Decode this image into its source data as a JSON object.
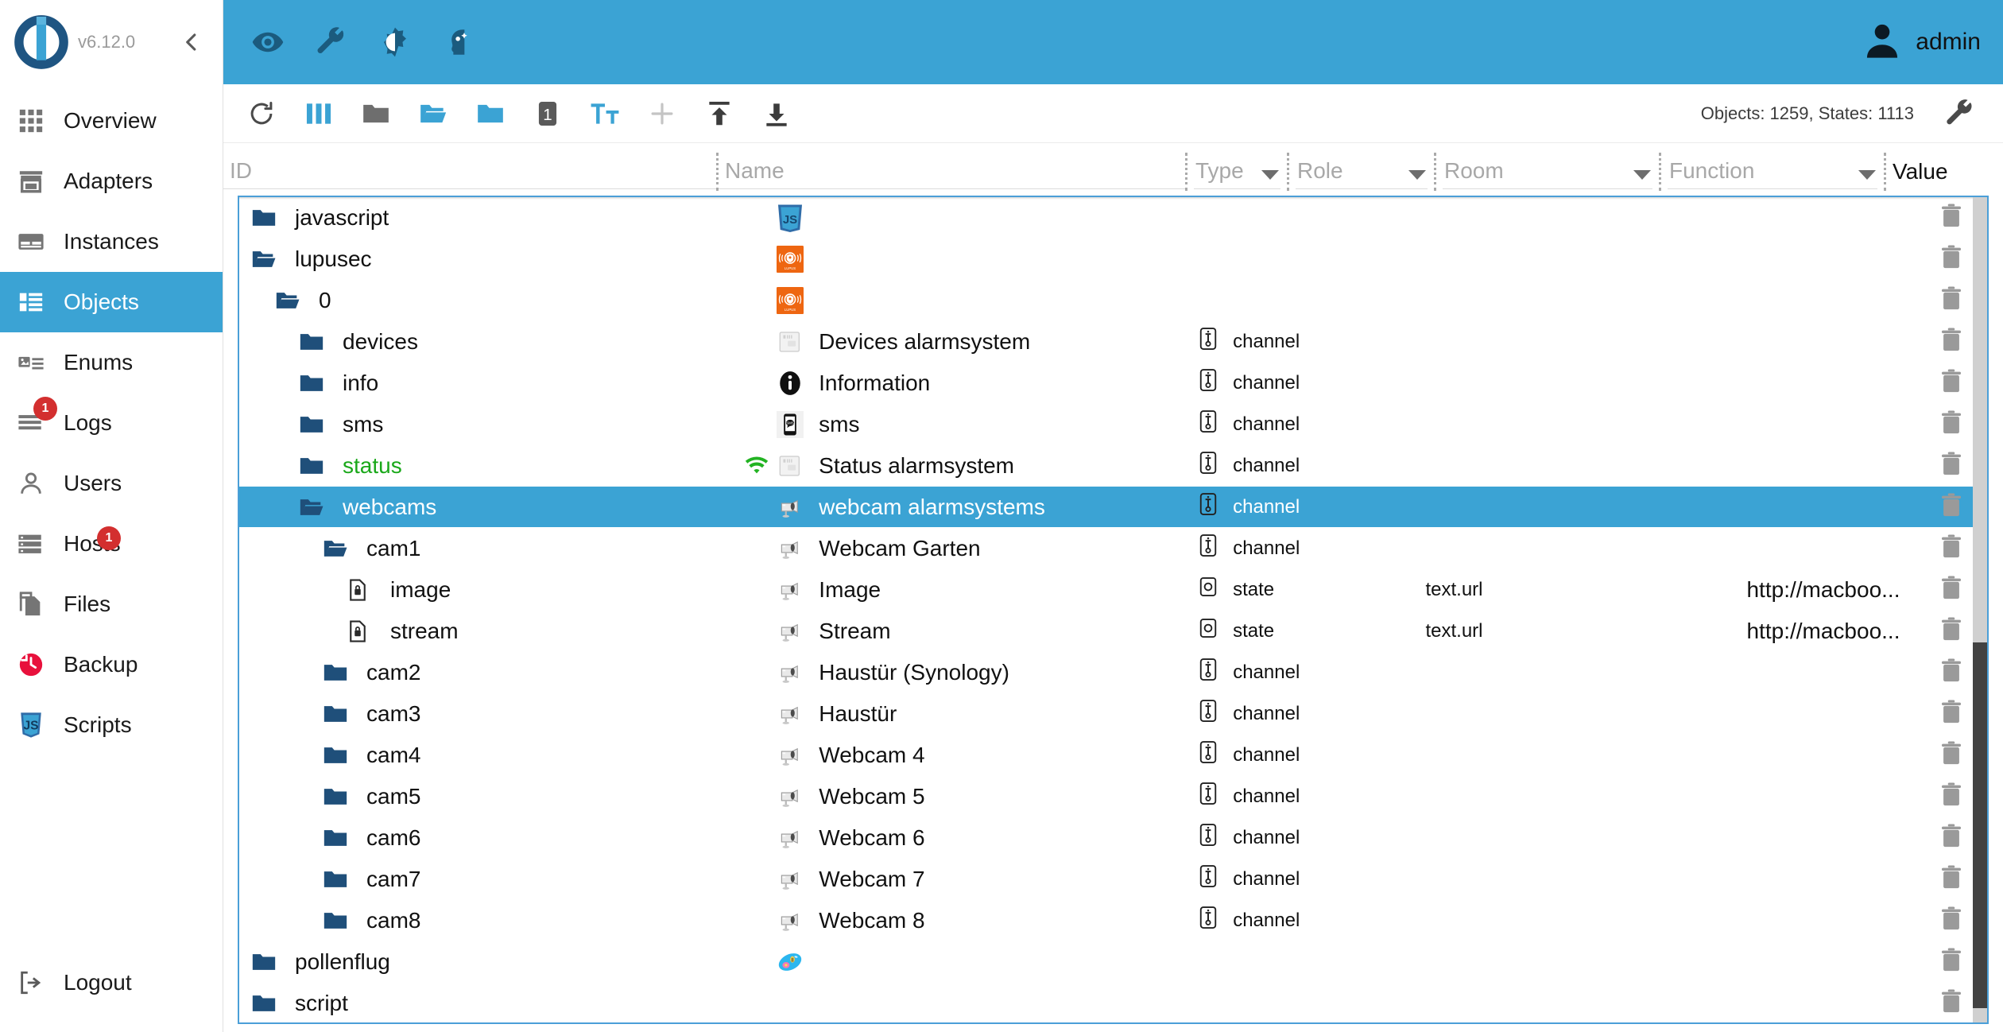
{
  "sidebar": {
    "version": "v6.12.0",
    "collapse_icon": "chevron-left-icon",
    "items": [
      {
        "label": "Overview",
        "icon": "grid-icon",
        "active": false,
        "badge": null
      },
      {
        "label": "Adapters",
        "icon": "shop-icon",
        "active": false,
        "badge": null
      },
      {
        "label": "Instances",
        "icon": "instances-icon",
        "active": false,
        "badge": null
      },
      {
        "label": "Objects",
        "icon": "list-icon",
        "active": true,
        "badge": null
      },
      {
        "label": "Enums",
        "icon": "enums-icon",
        "active": false,
        "badge": null
      },
      {
        "label": "Logs",
        "icon": "logs-icon",
        "active": false,
        "badge": "1"
      },
      {
        "label": "Users",
        "icon": "user-icon",
        "active": false,
        "badge": null
      },
      {
        "label": "Hosts",
        "icon": "hosts-icon",
        "active": false,
        "badge": "1"
      },
      {
        "label": "Files",
        "icon": "files-icon",
        "active": false,
        "badge": null
      },
      {
        "label": "Backup",
        "icon": "backup-icon",
        "active": false,
        "badge": null
      },
      {
        "label": "Scripts",
        "icon": "js-icon",
        "active": false,
        "badge": null
      }
    ],
    "logout": {
      "label": "Logout",
      "icon": "logout-icon"
    }
  },
  "appbar": {
    "background": "#3ba3d4",
    "buttons": [
      {
        "name": "eye-icon",
        "title": "Show/hide"
      },
      {
        "name": "wrench-icon",
        "title": "Settings"
      },
      {
        "name": "brightness-icon",
        "title": "Theme"
      },
      {
        "name": "expert-mode-icon",
        "title": "Expert mode"
      }
    ],
    "user": {
      "name": "admin",
      "icon": "avatar-icon"
    }
  },
  "toolbar": {
    "buttons": [
      {
        "name": "refresh-icon",
        "color": "#555555"
      },
      {
        "name": "columns-icon",
        "color": "#3ba3d4"
      },
      {
        "name": "folder-closed-icon",
        "color": "#6e6e6e"
      },
      {
        "name": "folder-open-icon",
        "color": "#3ba3d4"
      },
      {
        "name": "folder-icon",
        "color": "#3ba3d4"
      },
      {
        "name": "depth-one-icon",
        "color": "#5a5a5a"
      },
      {
        "name": "text-size-icon",
        "color": "#3ba3d4"
      },
      {
        "name": "add-icon",
        "color": "#c4c4c4"
      },
      {
        "name": "import-icon",
        "color": "#3c3c3c"
      },
      {
        "name": "export-icon",
        "color": "#3c3c3c"
      }
    ],
    "stats": "Objects: 1259, States: 1113",
    "settings_icon": "wrench-icon"
  },
  "filters": {
    "id": {
      "placeholder": "ID",
      "value": ""
    },
    "name": {
      "placeholder": "Name",
      "value": ""
    },
    "type": {
      "placeholder": "Type",
      "value": ""
    },
    "role": {
      "placeholder": "Role",
      "value": ""
    },
    "room": {
      "placeholder": "Room",
      "value": ""
    },
    "function": {
      "placeholder": "Function",
      "value": ""
    },
    "value_header": "Value"
  },
  "table": {
    "rows": [
      {
        "indent": 0,
        "id": "javascript",
        "id_icon": "folder-closed-icon",
        "id_color": "normal",
        "name": "",
        "name_icon": "js-logo",
        "wifi": false,
        "type": "",
        "role": "",
        "value": ""
      },
      {
        "indent": 0,
        "id": "lupusec",
        "id_icon": "folder-open-icon",
        "id_color": "normal",
        "name": "",
        "name_icon": "lupus-logo",
        "wifi": false,
        "type": "",
        "role": "",
        "value": ""
      },
      {
        "indent": 1,
        "id": "0",
        "id_icon": "folder-open-icon",
        "id_color": "normal",
        "name": "",
        "name_icon": "lupus-logo",
        "wifi": false,
        "type": "",
        "role": "",
        "value": ""
      },
      {
        "indent": 2,
        "id": "devices",
        "id_icon": "folder-closed-icon",
        "id_color": "normal",
        "name": "Devices alarmsystem",
        "name_icon": "alarm-panel",
        "wifi": false,
        "type": "channel",
        "role": "",
        "value": ""
      },
      {
        "indent": 2,
        "id": "info",
        "id_icon": "folder-closed-icon",
        "id_color": "normal",
        "name": "Information",
        "name_icon": "info-icon",
        "wifi": false,
        "type": "channel",
        "role": "",
        "value": ""
      },
      {
        "indent": 2,
        "id": "sms",
        "id_icon": "folder-closed-icon",
        "id_color": "normal",
        "name": "sms",
        "name_icon": "sms-icon",
        "wifi": false,
        "type": "channel",
        "role": "",
        "value": ""
      },
      {
        "indent": 2,
        "id": "status",
        "id_icon": "folder-closed-icon",
        "id_color": "green",
        "name": "Status alarmsystem",
        "name_icon": "alarm-panel",
        "wifi": true,
        "type": "channel",
        "role": "",
        "value": ""
      },
      {
        "indent": 2,
        "id": "webcams",
        "id_icon": "folder-open-icon",
        "id_color": "normal",
        "name": "webcam alarmsystems",
        "name_icon": "webcam-icon",
        "wifi": false,
        "type": "channel",
        "role": "",
        "value": "",
        "selected": true
      },
      {
        "indent": 3,
        "id": "cam1",
        "id_icon": "folder-open-icon",
        "id_color": "normal",
        "name": "Webcam Garten",
        "name_icon": "webcam-icon",
        "wifi": false,
        "type": "channel",
        "role": "",
        "value": ""
      },
      {
        "indent": 4,
        "id": "image",
        "id_icon": "state-file-icon",
        "id_color": "normal",
        "name": "Image",
        "name_icon": "webcam-icon",
        "wifi": false,
        "type": "state",
        "role": "text.url",
        "value": "http://macboo..."
      },
      {
        "indent": 4,
        "id": "stream",
        "id_icon": "state-file-icon",
        "id_color": "normal",
        "name": "Stream",
        "name_icon": "webcam-icon",
        "wifi": false,
        "type": "state",
        "role": "text.url",
        "value": "http://macboo..."
      },
      {
        "indent": 3,
        "id": "cam2",
        "id_icon": "folder-closed-icon",
        "id_color": "normal",
        "name": "Haustür (Synology)",
        "name_icon": "webcam-icon",
        "wifi": false,
        "type": "channel",
        "role": "",
        "value": ""
      },
      {
        "indent": 3,
        "id": "cam3",
        "id_icon": "folder-closed-icon",
        "id_color": "normal",
        "name": "Haustür",
        "name_icon": "webcam-icon",
        "wifi": false,
        "type": "channel",
        "role": "",
        "value": ""
      },
      {
        "indent": 3,
        "id": "cam4",
        "id_icon": "folder-closed-icon",
        "id_color": "normal",
        "name": "Webcam 4",
        "name_icon": "webcam-icon",
        "wifi": false,
        "type": "channel",
        "role": "",
        "value": ""
      },
      {
        "indent": 3,
        "id": "cam5",
        "id_icon": "folder-closed-icon",
        "id_color": "normal",
        "name": "Webcam 5",
        "name_icon": "webcam-icon",
        "wifi": false,
        "type": "channel",
        "role": "",
        "value": ""
      },
      {
        "indent": 3,
        "id": "cam6",
        "id_icon": "folder-closed-icon",
        "id_color": "normal",
        "name": "Webcam 6",
        "name_icon": "webcam-icon",
        "wifi": false,
        "type": "channel",
        "role": "",
        "value": ""
      },
      {
        "indent": 3,
        "id": "cam7",
        "id_icon": "folder-closed-icon",
        "id_color": "normal",
        "name": "Webcam 7",
        "name_icon": "webcam-icon",
        "wifi": false,
        "type": "channel",
        "role": "",
        "value": ""
      },
      {
        "indent": 3,
        "id": "cam8",
        "id_icon": "folder-closed-icon",
        "id_color": "normal",
        "name": "Webcam 8",
        "name_icon": "webcam-icon",
        "wifi": false,
        "type": "channel",
        "role": "",
        "value": ""
      },
      {
        "indent": 0,
        "id": "pollenflug",
        "id_icon": "folder-closed-icon",
        "id_color": "normal",
        "name": "",
        "name_icon": "pollen-logo",
        "wifi": false,
        "type": "",
        "role": "",
        "value": ""
      },
      {
        "indent": 0,
        "id": "script",
        "id_icon": "folder-closed-icon",
        "id_color": "normal",
        "name": "",
        "name_icon": "",
        "wifi": false,
        "type": "",
        "role": "",
        "value": ""
      }
    ],
    "delete_icon": "trash-icon",
    "selection_color": "#3ba3d4",
    "border_color": "#4b9fd8"
  }
}
